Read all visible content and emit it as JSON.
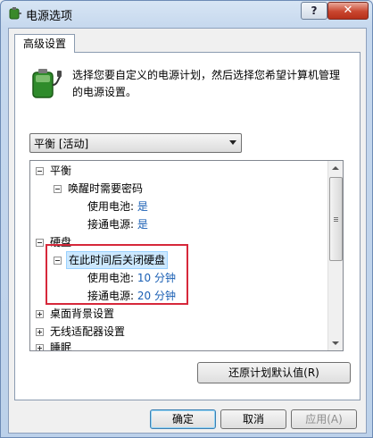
{
  "window": {
    "title": "电源选项",
    "help_label": "?",
    "close_label": "✕"
  },
  "tab": {
    "label": "高级设置"
  },
  "description": "选择您要自定义的电源计划，然后选择您希望计算机管理的电源设置。",
  "plan_select": {
    "selected": "平衡 [活动]"
  },
  "tree": {
    "items": [
      {
        "label": "平衡",
        "expanded": true
      },
      {
        "label": "唤醒时需要密码",
        "expanded": true
      },
      {
        "label": "使用电池:",
        "value": "是"
      },
      {
        "label": "接通电源:",
        "value": "是"
      },
      {
        "label": "硬盘",
        "expanded": true
      },
      {
        "label": "在此时间后关闭硬盘",
        "expanded": true,
        "selected": true
      },
      {
        "label": "使用电池:",
        "value": "10 分钟"
      },
      {
        "label": "接通电源:",
        "value": "20 分钟"
      },
      {
        "label": "桌面背景设置",
        "expanded": false
      },
      {
        "label": "无线适配器设置",
        "expanded": false
      },
      {
        "label": "睡眠",
        "expanded": false
      }
    ]
  },
  "buttons": {
    "restore": "还原计划默认值(R)",
    "ok": "确定",
    "cancel": "取消",
    "apply": "应用(A)"
  },
  "colors": {
    "value_text": "#1a5fb4",
    "highlight_box": "#d6283a",
    "selection": "#cce8ff"
  }
}
